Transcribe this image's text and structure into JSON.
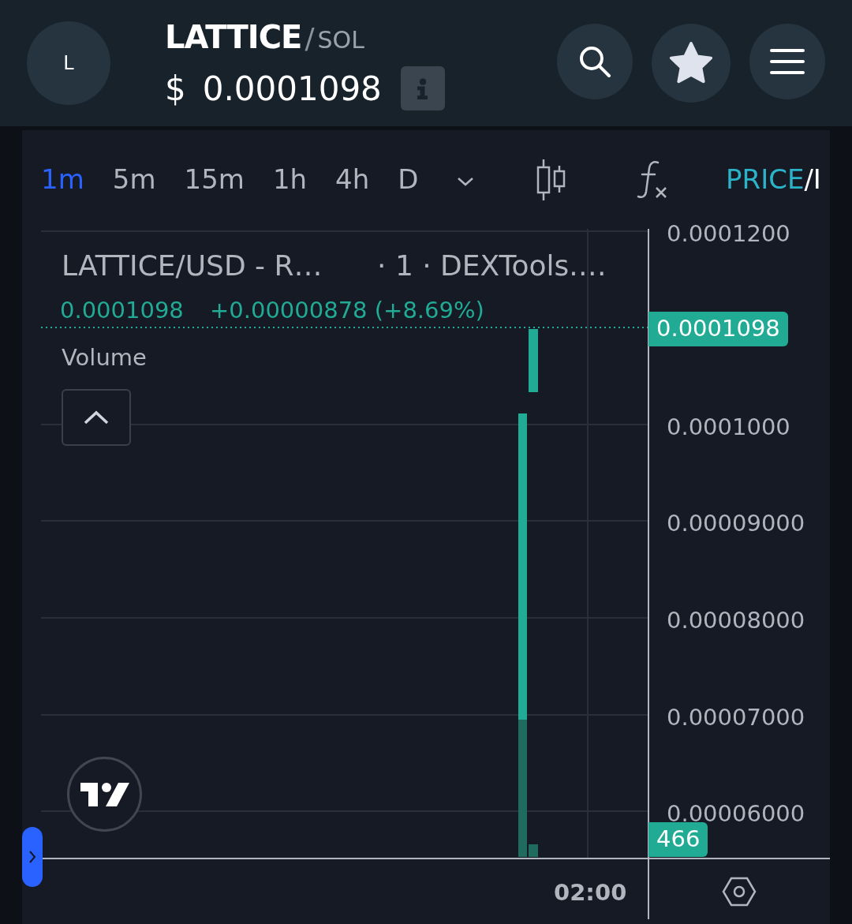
{
  "header": {
    "avatar_letter": "L",
    "symbol": "LATTICE",
    "separator": "/",
    "quote": "SOL",
    "currency": "$",
    "price": "0.0001098"
  },
  "toolbar": {
    "intervals": [
      {
        "label": "1m",
        "selected": true
      },
      {
        "label": "5m",
        "selected": false
      },
      {
        "label": "15m",
        "selected": false
      },
      {
        "label": "1h",
        "selected": false
      },
      {
        "label": "4h",
        "selected": false
      },
      {
        "label": "D",
        "selected": false
      }
    ],
    "price_label": "PRICE",
    "price_separator": "/",
    "other_label": "I"
  },
  "legend": {
    "title": "LATTICE/USD - R…",
    "details": "· 1 · DEXTools.…",
    "price": "0.0001098",
    "change": "+0.00000878 (+8.69%)",
    "volume_label": "Volume"
  },
  "price_axis": {
    "labels": [
      "0.0001200",
      "0.0001000",
      "0.00009000",
      "0.00008000",
      "0.00007000",
      "0.00006000"
    ],
    "last_price_tag": "0.0001098",
    "volume_tag": "466"
  },
  "time_axis": {
    "labels": [
      "02:00"
    ]
  }
}
